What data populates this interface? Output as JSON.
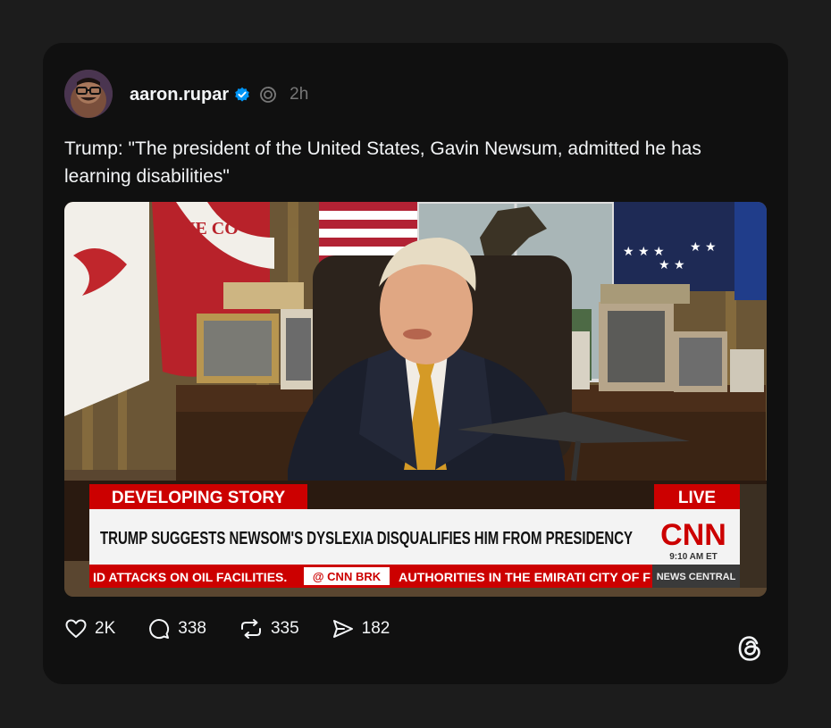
{
  "post": {
    "username": "aaron.rupar",
    "time": "2h",
    "text": "Trump: \"The president of the United States, Gavin Newsum, admitted he has learning disabilities\""
  },
  "media": {
    "banner_label": "DEVELOPING STORY",
    "live_label": "LIVE",
    "headline": "TRUMP SUGGESTS NEWSOM'S DYSLEXIA DISQUALIFIES HIM FROM PRESIDENCY",
    "network": "CNN",
    "clock": "9:10 AM ET",
    "ticker_left": "ID ATTACKS ON OIL FACILITIES.",
    "ticker_handle": "@ CNN BRK",
    "ticker_right": "AUTHORITIES IN THE EMIRATI CITY OF F",
    "ticker_show": "NEWS CENTRAL",
    "flag_text": "NE CO"
  },
  "actions": {
    "likes": "2K",
    "replies": "338",
    "reposts": "335",
    "shares": "182"
  },
  "colors": {
    "background": "#1c1c1c",
    "card": "#101010",
    "verified": "#0095f6",
    "cnn_red": "#cc0000"
  }
}
